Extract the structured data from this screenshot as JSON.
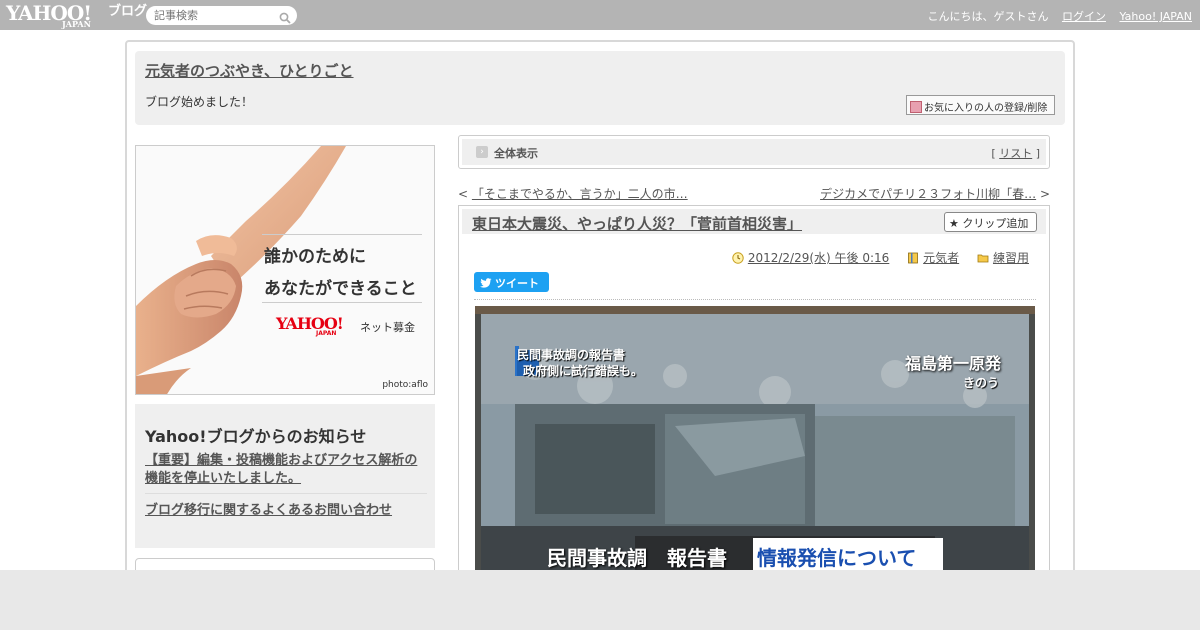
{
  "topbar": {
    "logo_yahoo": "YAHOO!",
    "logo_japan": "JAPAN",
    "logo_blog": "ブログ",
    "search_placeholder": "記事検索",
    "greeting": "こんにちは、ゲストさん",
    "login": "ログイン",
    "yahoo_japan": "Yahoo! JAPAN"
  },
  "header": {
    "blog_title": "元気者のつぶやき、ひとりごと",
    "blog_description": "ブログ始めました！",
    "favorite_button": "お気に入りの人の登録/削除"
  },
  "banner": {
    "line1": "誰かのために",
    "line2": "あなたができること",
    "logo": "YAHOO!",
    "logo_japan": "JAPAN",
    "service": "ネット募金",
    "credit": "photo:aflo"
  },
  "notice": {
    "heading": "Yahoo!ブログからのお知らせ",
    "items": [
      "【重要】編集・投稿機能およびアクセス解析の機能を停止いたしました。",
      "ブログ移行に関するよくあるお問い合わせ"
    ]
  },
  "allview": {
    "label": "全体表示",
    "list_link": "リスト",
    "bracket_open": "[",
    "bracket_close": "]"
  },
  "nav": {
    "prev": "「そこまでやるか、言うか」二人の市…",
    "next": "デジカメでパチリ２３フォト川柳「春…",
    "prev_arrow": "<",
    "next_arrow": ">"
  },
  "article": {
    "title": "東日本大震災、やっぱり人災？「菅前首相災害」",
    "clip_button": "クリップ追加",
    "date": "2012/2/29(水) 午後 0:16",
    "author": "元気者",
    "category": "練習用",
    "tweet": "ツイート"
  },
  "photo": {
    "caption_top_left": "民間事故調の報告書",
    "caption_top_left2": "政府側に試行錯誤も。",
    "caption_top_right": "福島第一原発",
    "caption_top_right2": "きのう",
    "caption_bottom": "民間事故調　報告書",
    "caption_bottom_box": "情報発信について"
  },
  "colors": {
    "topbar": "#b4b4b4",
    "tweet": "#1da1f2",
    "yahoo_red": "#e60012"
  }
}
